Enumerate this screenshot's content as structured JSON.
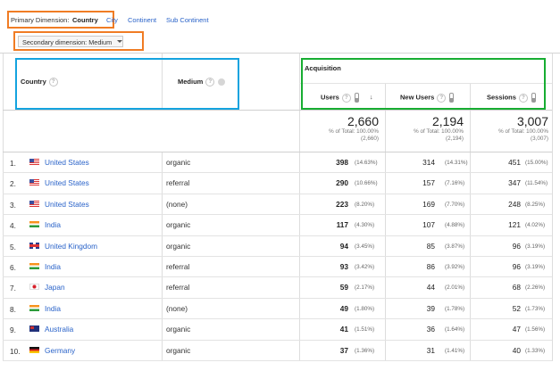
{
  "dimensions": {
    "primary_label": "Primary Dimension:",
    "primary_value": "Country",
    "links": [
      "City",
      "Continent",
      "Sub Continent"
    ],
    "secondary_label": "Secondary dimension: Medium"
  },
  "headers": {
    "country": "Country",
    "medium": "Medium",
    "group": "Acquisition",
    "users": "Users",
    "new_users": "New Users",
    "sessions": "Sessions"
  },
  "totals": {
    "users": {
      "value": "2,660",
      "pct": "% of Total: 100.00%",
      "base": "(2,660)"
    },
    "new_users": {
      "value": "2,194",
      "pct": "% of Total: 100.00%",
      "base": "(2,194)"
    },
    "sessions": {
      "value": "3,007",
      "pct": "% of Total: 100.00%",
      "base": "(3,007)"
    }
  },
  "rows": [
    {
      "n": "1.",
      "flag": "us",
      "country": "United States",
      "medium": "organic",
      "users": "398",
      "users_pct": "(14.63%)",
      "new": "314",
      "new_pct": "(14.31%)",
      "sess": "451",
      "sess_pct": "(15.00%)"
    },
    {
      "n": "2.",
      "flag": "us",
      "country": "United States",
      "medium": "referral",
      "users": "290",
      "users_pct": "(10.66%)",
      "new": "157",
      "new_pct": "(7.16%)",
      "sess": "347",
      "sess_pct": "(11.54%)"
    },
    {
      "n": "3.",
      "flag": "us",
      "country": "United States",
      "medium": "(none)",
      "users": "223",
      "users_pct": "(8.20%)",
      "new": "169",
      "new_pct": "(7.70%)",
      "sess": "248",
      "sess_pct": "(8.25%)"
    },
    {
      "n": "4.",
      "flag": "in",
      "country": "India",
      "medium": "organic",
      "users": "117",
      "users_pct": "(4.30%)",
      "new": "107",
      "new_pct": "(4.88%)",
      "sess": "121",
      "sess_pct": "(4.02%)"
    },
    {
      "n": "5.",
      "flag": "uk",
      "country": "United Kingdom",
      "medium": "organic",
      "users": "94",
      "users_pct": "(3.45%)",
      "new": "85",
      "new_pct": "(3.87%)",
      "sess": "96",
      "sess_pct": "(3.19%)"
    },
    {
      "n": "6.",
      "flag": "in",
      "country": "India",
      "medium": "referral",
      "users": "93",
      "users_pct": "(3.42%)",
      "new": "86",
      "new_pct": "(3.92%)",
      "sess": "96",
      "sess_pct": "(3.19%)"
    },
    {
      "n": "7.",
      "flag": "jp",
      "country": "Japan",
      "medium": "referral",
      "users": "59",
      "users_pct": "(2.17%)",
      "new": "44",
      "new_pct": "(2.01%)",
      "sess": "68",
      "sess_pct": "(2.26%)"
    },
    {
      "n": "8.",
      "flag": "in",
      "country": "India",
      "medium": "(none)",
      "users": "49",
      "users_pct": "(1.80%)",
      "new": "39",
      "new_pct": "(1.78%)",
      "sess": "52",
      "sess_pct": "(1.73%)"
    },
    {
      "n": "9.",
      "flag": "au",
      "country": "Australia",
      "medium": "organic",
      "users": "41",
      "users_pct": "(1.51%)",
      "new": "36",
      "new_pct": "(1.64%)",
      "sess": "47",
      "sess_pct": "(1.56%)"
    },
    {
      "n": "10.",
      "flag": "de",
      "country": "Germany",
      "medium": "organic",
      "users": "37",
      "users_pct": "(1.36%)",
      "new": "31",
      "new_pct": "(1.41%)",
      "sess": "40",
      "sess_pct": "(1.33%)"
    }
  ],
  "colors": {
    "highlight_orange": "#f07c24",
    "highlight_blue": "#14a3df",
    "highlight_green": "#17ad32",
    "link": "#2a63c9"
  }
}
